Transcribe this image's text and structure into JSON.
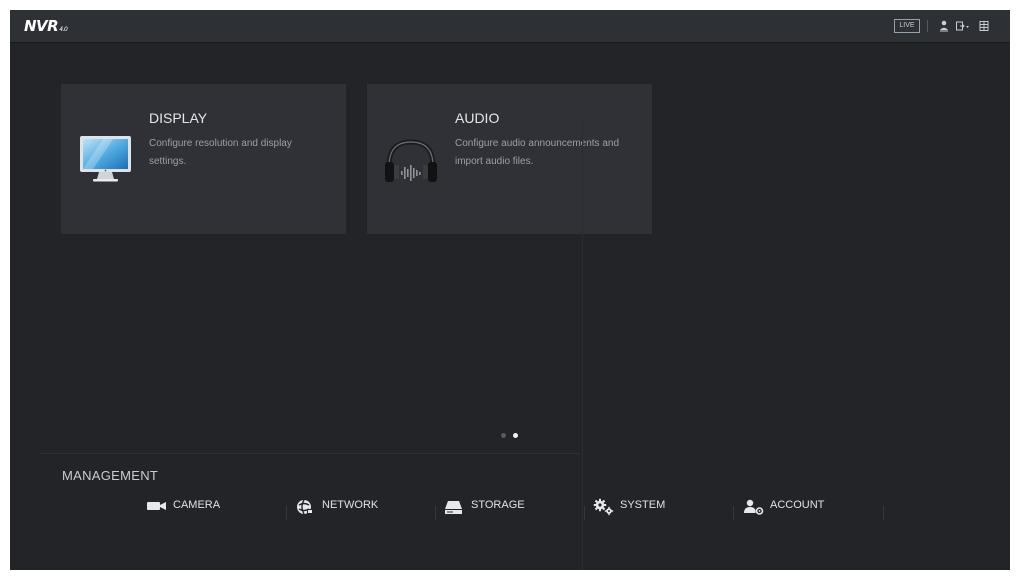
{
  "header": {
    "logo_text": "NVR",
    "logo_version": "4.0",
    "live_button": "LIVE",
    "icons": [
      "user-icon",
      "logout-icon",
      "menu-grid-icon"
    ]
  },
  "tiles": [
    {
      "title": "DISPLAY",
      "description": "Configure resolution and display settings.",
      "icon": "monitor-icon"
    },
    {
      "title": "AUDIO",
      "description": "Configure audio announcements and import audio files.",
      "icon": "headphones-icon"
    }
  ],
  "pager": {
    "total": 2,
    "active": 2
  },
  "management": {
    "title": "MANAGEMENT",
    "items": [
      {
        "label": "CAMERA",
        "icon": "camera-icon"
      },
      {
        "label": "NETWORK",
        "icon": "network-icon"
      },
      {
        "label": "STORAGE",
        "icon": "storage-icon"
      },
      {
        "label": "SYSTEM",
        "icon": "gears-icon"
      },
      {
        "label": "ACCOUNT",
        "icon": "account-icon"
      }
    ]
  },
  "colors": {
    "background": "#222428",
    "topbar": "#2d3035",
    "tile": "#2f3136",
    "text": "#e4e6ea",
    "muted_text": "#9aa0a8"
  }
}
